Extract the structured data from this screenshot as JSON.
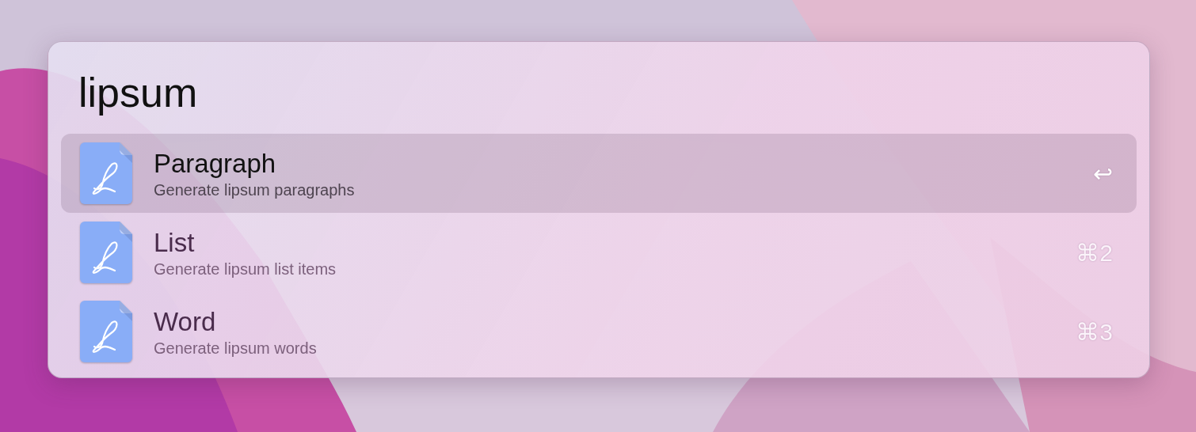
{
  "search": {
    "value": "lipsum"
  },
  "results": [
    {
      "title": "Paragraph",
      "subtitle": "Generate lipsum paragraphs",
      "shortcut": "↩",
      "selected": true
    },
    {
      "title": "List",
      "subtitle": "Generate lipsum list items",
      "shortcut": "⌘2",
      "selected": false
    },
    {
      "title": "Word",
      "subtitle": "Generate lipsum words",
      "shortcut": "⌘3",
      "selected": false
    }
  ]
}
